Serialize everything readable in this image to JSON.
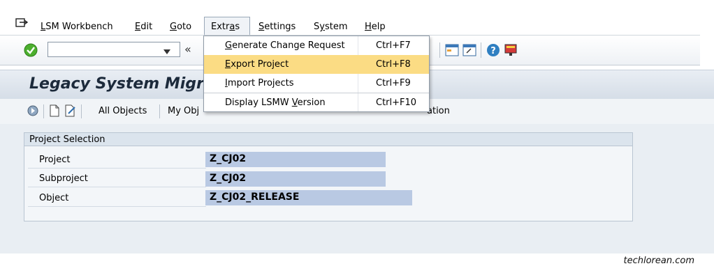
{
  "menubar": {
    "items": [
      {
        "pre": "",
        "u": "L",
        "post": "SM Workbench"
      },
      {
        "pre": "",
        "u": "E",
        "post": "dit"
      },
      {
        "pre": "",
        "u": "G",
        "post": "oto"
      },
      {
        "pre": "Extr",
        "u": "a",
        "post": "s"
      },
      {
        "pre": "",
        "u": "S",
        "post": "ettings"
      },
      {
        "pre": "S",
        "u": "y",
        "post": "stem"
      },
      {
        "pre": "",
        "u": "H",
        "post": "elp"
      }
    ]
  },
  "toolbar": {
    "command_field_value": "",
    "back_glyph": "«"
  },
  "title": "Legacy System Migrat",
  "app_toolbar": {
    "all_objects": "All Objects",
    "my_objects": "My Obj",
    "trailing": "ation"
  },
  "project_selection": {
    "header": "Project Selection",
    "rows": [
      {
        "label": "Project",
        "value": "Z_CJ02"
      },
      {
        "label": "Subproject",
        "value": "Z_CJ02"
      },
      {
        "label": "Object",
        "value": "Z_CJ02_RELEASE"
      }
    ]
  },
  "extras_menu": {
    "items": [
      {
        "pre": "",
        "u": "G",
        "post": "enerate Change Request",
        "shortcut": "Ctrl+F7",
        "active": false
      },
      {
        "pre": "",
        "u": "E",
        "post": "xport Project",
        "shortcut": "Ctrl+F8",
        "active": true
      },
      {
        "pre": "",
        "u": "I",
        "post": "mport Projects",
        "shortcut": "Ctrl+F9",
        "active": false
      },
      {
        "pre": "Display LSMW ",
        "u": "V",
        "post": "ersion",
        "shortcut": "Ctrl+F10",
        "active": false
      }
    ]
  },
  "colors": {
    "highlight": "#fbdc84",
    "field_bg": "#b9c9e3",
    "title_color": "#1c2a3b"
  },
  "icons": [
    "exit-icon",
    "checkmark-icon",
    "dropdown-arrow-icon",
    "execute-icon",
    "new-document-icon",
    "edit-icon",
    "layout-icon",
    "help-icon",
    "monitor-icon"
  ],
  "watermark": "techlorean.com"
}
